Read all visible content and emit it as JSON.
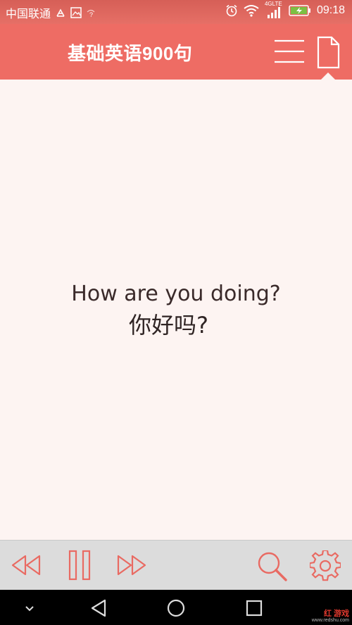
{
  "status_bar": {
    "carrier": "中国联通",
    "network": "4G",
    "network_sub": "LTE",
    "time": "09:18",
    "icons": [
      "usb-icon",
      "image-icon",
      "question-icon",
      "alarm-icon",
      "wifi-icon",
      "signal-icon",
      "battery-charging-icon"
    ]
  },
  "header": {
    "title": "基础英语900句",
    "buttons": [
      "menu-icon",
      "document-icon"
    ]
  },
  "content": {
    "sentence_en": "How are you doing?",
    "sentence_zh": "你好吗?"
  },
  "controls": {
    "buttons": [
      "rewind-icon",
      "pause-icon",
      "fast-forward-icon",
      "search-icon",
      "gear-icon"
    ]
  },
  "nav_bar": {
    "buttons": [
      "hide-keyboard-icon",
      "back-icon",
      "home-icon",
      "recents-icon"
    ]
  },
  "watermark": {
    "brand": "红 游戏",
    "url": "www.redshu.com"
  },
  "colors": {
    "accent": "#ee6c64",
    "content_bg": "#fdf4f2",
    "controls_bg": "#dcdcdc",
    "control_icon": "#e96a62"
  }
}
